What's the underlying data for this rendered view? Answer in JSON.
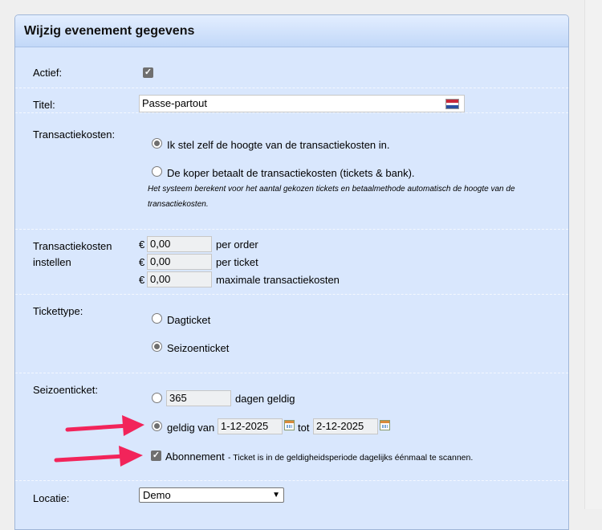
{
  "panel": {
    "title": "Wijzig evenement gegevens"
  },
  "actief": {
    "label": "Actief:",
    "checked": true
  },
  "titel": {
    "label": "Titel:",
    "value": "Passe-partout",
    "flag_icon": "dutch-flag-icon"
  },
  "transactiekosten": {
    "label": "Transactiekosten:",
    "option_self": "Ik stel zelf de hoogte van de transactiekosten in.",
    "option_buyer": "De koper betaalt de transactiekosten (tickets & bank).",
    "note_line1": "Het systeem berekent voor het aantal gekozen tickets en betaalmethode automatisch de hoogte van de",
    "note_line2": "transactiekosten.",
    "selected": "self"
  },
  "instellen": {
    "label_line1": "Transactiekosten",
    "label_line2": "instellen",
    "currency": "€",
    "rows": [
      {
        "value": "0,00",
        "suffix": "per order"
      },
      {
        "value": "0,00",
        "suffix": "per ticket"
      },
      {
        "value": "0,00",
        "suffix": "maximale transactiekosten"
      }
    ]
  },
  "tickettype": {
    "label": "Tickettype:",
    "option_day": "Dagticket",
    "option_season": "Seizoenticket",
    "selected": "season"
  },
  "seizoenticket": {
    "label": "Seizoenticket:",
    "days_value": "365",
    "days_suffix": "dagen geldig",
    "valid_from_label": "geldig van",
    "valid_from": "1-12-2025",
    "to_label": "tot",
    "valid_to": "2-12-2025",
    "subscription_label": "Abonnement",
    "subscription_note": "- Ticket is in de geldigheidsperiode dagelijks éénmaal te scannen.",
    "subscription_checked": true
  },
  "locatie": {
    "label": "Locatie:",
    "value": "Demo"
  },
  "colors": {
    "arrow": "#f2245a",
    "panel_bg": "#d9e7fd",
    "header_bg": "#c2d8f8"
  }
}
